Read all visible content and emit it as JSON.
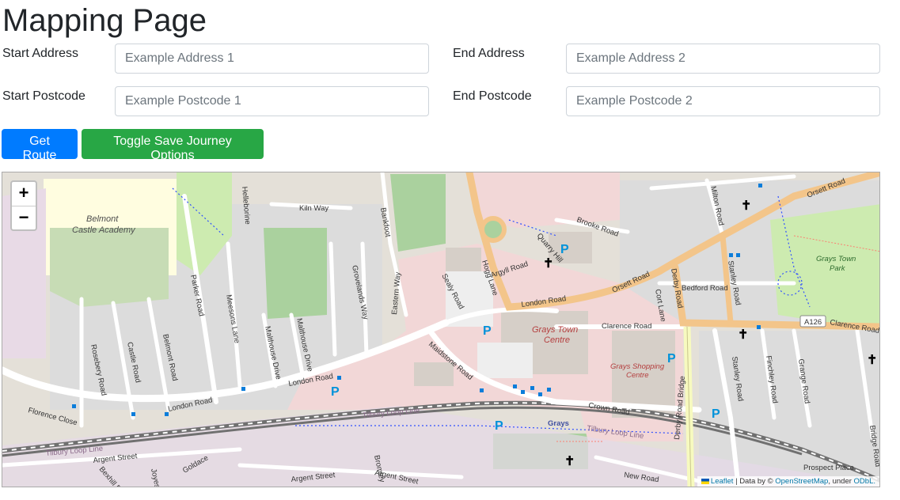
{
  "page": {
    "title": "Mapping Page"
  },
  "form": {
    "start_address_label": "Start Address",
    "start_address_placeholder": "Example Address 1",
    "end_address_label": "End Address",
    "end_address_placeholder": "Example Address 2",
    "start_postcode_label": "Start Postcode",
    "start_postcode_placeholder": "Example Postcode 1",
    "end_postcode_label": "End Postcode",
    "end_postcode_placeholder": "Example Postcode 2"
  },
  "buttons": {
    "get_route": "Get Route",
    "toggle_save": "Toggle Save Journey Options"
  },
  "map": {
    "zoom_in": "+",
    "zoom_out": "−",
    "attribution": {
      "leaflet": "Leaflet",
      "data_by": "| Data by ©",
      "osm": "OpenStreetMap",
      "under": ", under",
      "odbl": "ODbL."
    },
    "labels": {
      "belmont": "Belmont",
      "castle_academy": "Castle Academy",
      "helleborine": "Helleborine",
      "kiln_way": "Kiln Way",
      "bankfoot": "Bankfoot",
      "orsett_road_ne": "Orsett Road",
      "milton_road": "Milton Road",
      "brooke_road": "Brooke Road",
      "quarry_hill": "Quarry Hill",
      "argyll_road": "Argyll Road",
      "hogg_lane": "Hogg Lane",
      "sealy_road": "Sealy Road",
      "eastern_way": "Eastern Way",
      "grovelands_way": "Grovelands Way",
      "parker_road": "Parker Road",
      "meesons_lane": "Meesons Lane",
      "london_road_center": "London Road",
      "orsett_road": "Orsett Road",
      "derby_road": "Derby Road",
      "cort_lane": "Cort Lane",
      "bedford_road": "Bedford Road",
      "stanley_road_n": "Stanley Road",
      "grays_town_park_1": "Grays Town",
      "grays_town_park_2": "Park",
      "clarence_road": "Clarence Road",
      "a126": "A126",
      "clarence_road_e": "Clarence Road",
      "grays_town_centre_1": "Grays Town",
      "grays_town_centre_2": "Centre",
      "grays_shopping_1": "Grays Shopping",
      "grays_shopping_2": "Centre",
      "maidstone_road": "Maidstone Road",
      "rosebery_road": "Rosebery Road",
      "castle_road": "Castle Road",
      "belmont_road": "Belmont Road",
      "malthouse_drive_1": "Malthouse Drive",
      "malthouse_drive_2": "Malthouse Drive",
      "london_road_mid": "London Road",
      "london_road_w": "London Road",
      "florence_close": "Florence Close",
      "stanley_road_s": "Stanley Road",
      "finchley_road": "Finchley Road",
      "grange_road": "Grange Road",
      "derby_road_bridge": "Derby Road Bridge",
      "crown_road": "Crown Road",
      "tilbury_loop_1": "Tilbury Loop Line",
      "tilbury_loop_2": "Tilbury Loop Line",
      "tilbury_loop_3": "Tilbury Loop Line",
      "grays": "Grays",
      "bridge_road": "Bridge Road",
      "prospect_place": "Prospect Place",
      "argent_street_1": "Argent Street",
      "argent_street_2": "Argent Street",
      "argent_street_3": "Argent Street",
      "goldace": "Goldace",
      "bromley": "Bromley",
      "new_road": "New Road",
      "bexhill_road": "Bexhill Road",
      "joyes": "Joyes"
    }
  }
}
